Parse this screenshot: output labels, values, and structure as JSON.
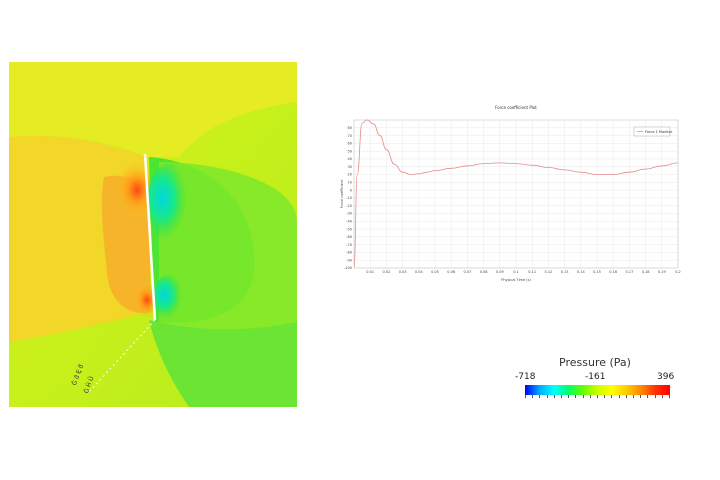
{
  "field": {
    "annotation_lines": [
      "Ĝ ƌ Ę ƌ",
      "Ġ Ĥ Ũ"
    ]
  },
  "colorbar": {
    "title": "Pressure (Pa)",
    "min_label": "-718",
    "mid_label": "-161",
    "max_label": "396"
  },
  "chart_data": {
    "type": "line",
    "title": "Force coefficient Plot",
    "xlabel": "Physical Time (s)",
    "ylabel": "Force coefficient",
    "legend": "Force 1 Monitor",
    "legend_position": "top-right",
    "grid": true,
    "xlim": [
      0.0,
      0.2
    ],
    "ylim": [
      -100,
      90
    ],
    "x_ticks": [
      "0.01",
      "0.02",
      "0.03",
      "0.04",
      "0.05",
      "0.06",
      "0.07",
      "0.08",
      "0.09",
      "0.1",
      "0.11",
      "0.12",
      "0.13",
      "0.14",
      "0.15",
      "0.16",
      "0.17",
      "0.18",
      "0.19",
      "0.2"
    ],
    "y_ticks": [
      "80",
      "70",
      "60",
      "50",
      "40",
      "30",
      "20",
      "10",
      "0",
      "-10",
      "-20",
      "-30",
      "-40",
      "-50",
      "-60",
      "-70",
      "-80",
      "-90",
      "-100"
    ],
    "series": [
      {
        "name": "Force 1 Monitor",
        "color": "#e88a8a",
        "x": [
          0.0,
          0.002,
          0.005,
          0.008,
          0.012,
          0.016,
          0.02,
          0.025,
          0.03,
          0.035,
          0.04,
          0.045,
          0.05,
          0.06,
          0.07,
          0.08,
          0.09,
          0.1,
          0.11,
          0.12,
          0.13,
          0.14,
          0.15,
          0.16,
          0.17,
          0.18,
          0.19,
          0.2
        ],
        "y": [
          -100,
          20,
          86,
          90,
          85,
          70,
          52,
          33,
          23,
          20,
          21,
          23,
          25,
          28,
          31,
          34,
          35,
          34,
          32,
          29,
          26,
          23,
          20,
          20,
          23,
          27,
          31,
          35
        ]
      }
    ]
  }
}
